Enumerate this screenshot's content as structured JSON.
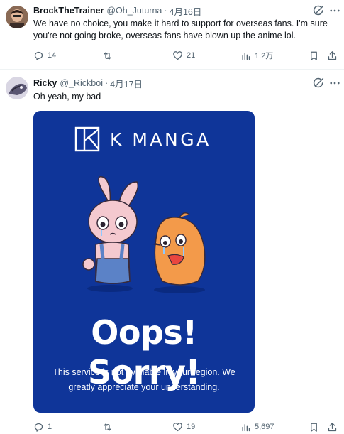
{
  "tweets": [
    {
      "author_name": "BrockTheTrainer",
      "handle": "@Oh_Juturna",
      "separator": "·",
      "date": "4月16日",
      "text": "We have no choice, you make it hard to support for overseas fans. I'm sure you're not going broke, overseas fans have blown up the anime lol.",
      "replies": "14",
      "retweets": "",
      "likes": "21",
      "views": "1.2万"
    },
    {
      "author_name": "Ricky",
      "handle": "@_Rickboi",
      "separator": "·",
      "date": "4月17日",
      "text": "Oh yeah, my bad",
      "replies": "1",
      "retweets": "",
      "likes": "19",
      "views": "5,697",
      "media": {
        "logo_text": "K MANGA",
        "headline": "Oops! Sorry!",
        "message": "This service is not available in your region. We greatly appreciate your understanding.",
        "background_color": "#0f3599"
      }
    }
  ],
  "icons": {
    "grok": "grok-icon",
    "more": "more-icon",
    "reply": "reply-icon",
    "retweet": "retweet-icon",
    "like": "heart-icon",
    "views": "views-icon",
    "bookmark": "bookmark-icon",
    "share": "share-icon"
  },
  "colors": {
    "text_primary": "#0f1419",
    "text_secondary": "#536471",
    "divider": "#eff3f4",
    "kmanga_blue": "#0f3599"
  }
}
